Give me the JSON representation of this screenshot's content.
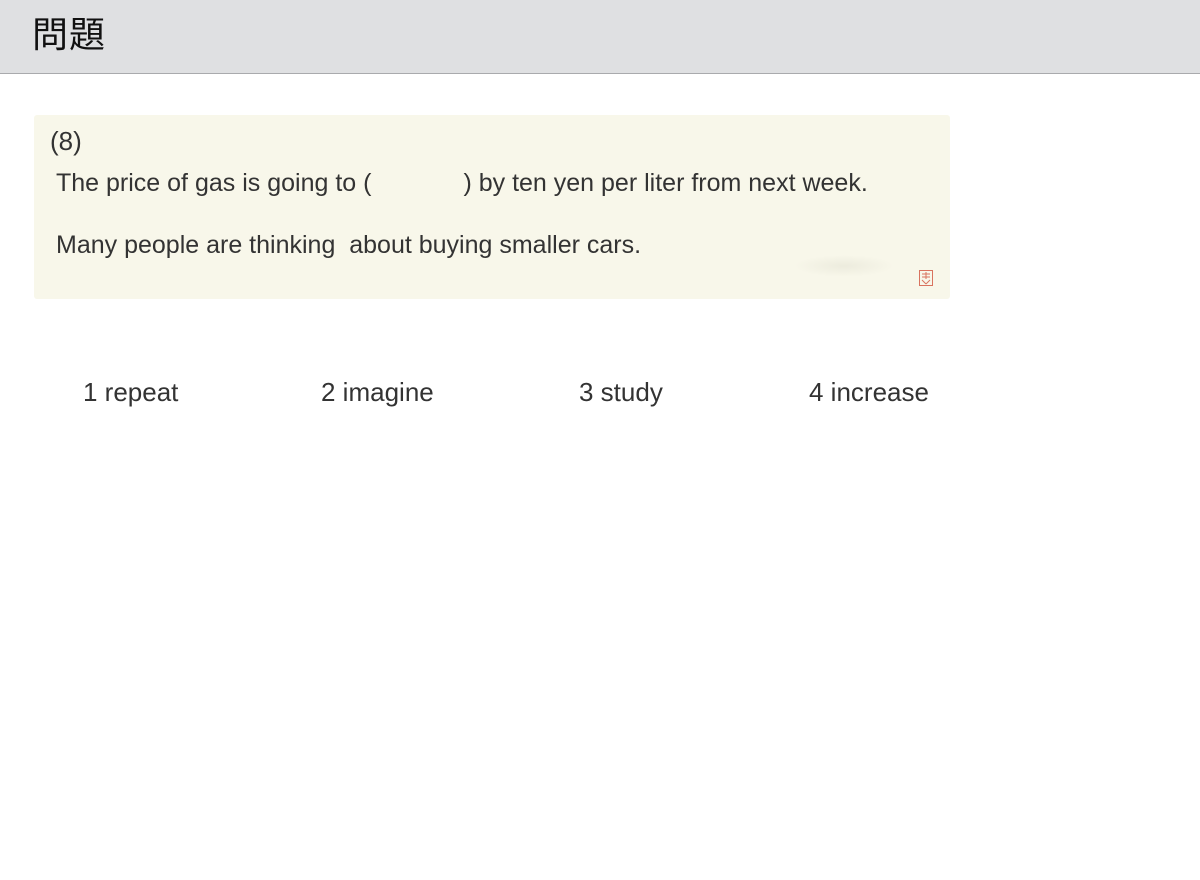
{
  "header": {
    "title": "問題"
  },
  "question": {
    "number": "(8)",
    "line1_before": "The price of gas is going to (",
    "line1_after": ") by ten yen per liter from next week.",
    "line2": "Many people are thinking  about buying smaller cars."
  },
  "choices": [
    {
      "label": "1 repeat"
    },
    {
      "label": "2 imagine"
    },
    {
      "label": "3 study"
    },
    {
      "label": "4 increase"
    }
  ],
  "colors": {
    "header_bg": "#dfe0e2",
    "card_bg": "#f8f7ea",
    "text": "#333333",
    "stamp": "#d9735f"
  }
}
